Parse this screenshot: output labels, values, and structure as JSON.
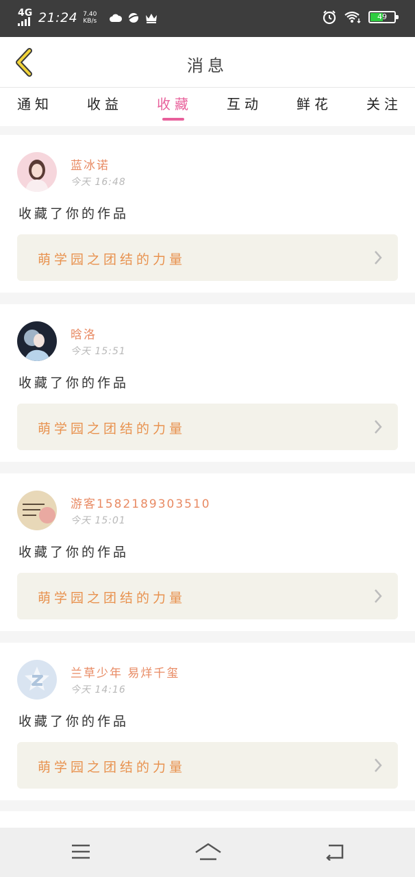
{
  "status_bar": {
    "network": "4G",
    "time": "21:24",
    "speed_value": "7.40",
    "speed_unit": "KB/s",
    "battery": "49",
    "left_icons": [
      "weather-icon",
      "planet-icon",
      "crown-icon"
    ],
    "right_icons": [
      "alarm-icon",
      "wifi-icon",
      "battery-icon"
    ]
  },
  "header": {
    "title": "消息",
    "back_icon": "chevron-left-icon"
  },
  "tabs": [
    {
      "label": "通知"
    },
    {
      "label": "收益"
    },
    {
      "label": "收藏"
    },
    {
      "label": "互动"
    },
    {
      "label": "鲜花"
    },
    {
      "label": "关注"
    }
  ],
  "active_tab": "收藏",
  "accent_color": "#e8609b",
  "name_color": "#e88a63",
  "messages": [
    {
      "user": "蓝冰诺",
      "time": "今天 16:48",
      "action": "收藏了你的作品",
      "work": "萌学园之团结的力量"
    },
    {
      "user": "晗洛",
      "time": "今天 15:51",
      "action": "收藏了你的作品",
      "work": "萌学园之团结的力量"
    },
    {
      "user": "游客1582189303510",
      "time": "今天 15:01",
      "action": "收藏了你的作品",
      "work": "萌学园之团结的力量"
    },
    {
      "user": "兰草少年  易烊千玺",
      "time": "今天 14:16",
      "action": "收藏了你的作品",
      "work": "萌学园之团结的力量"
    }
  ],
  "bottom_nav": [
    "menu-icon",
    "home-icon",
    "back-icon"
  ]
}
